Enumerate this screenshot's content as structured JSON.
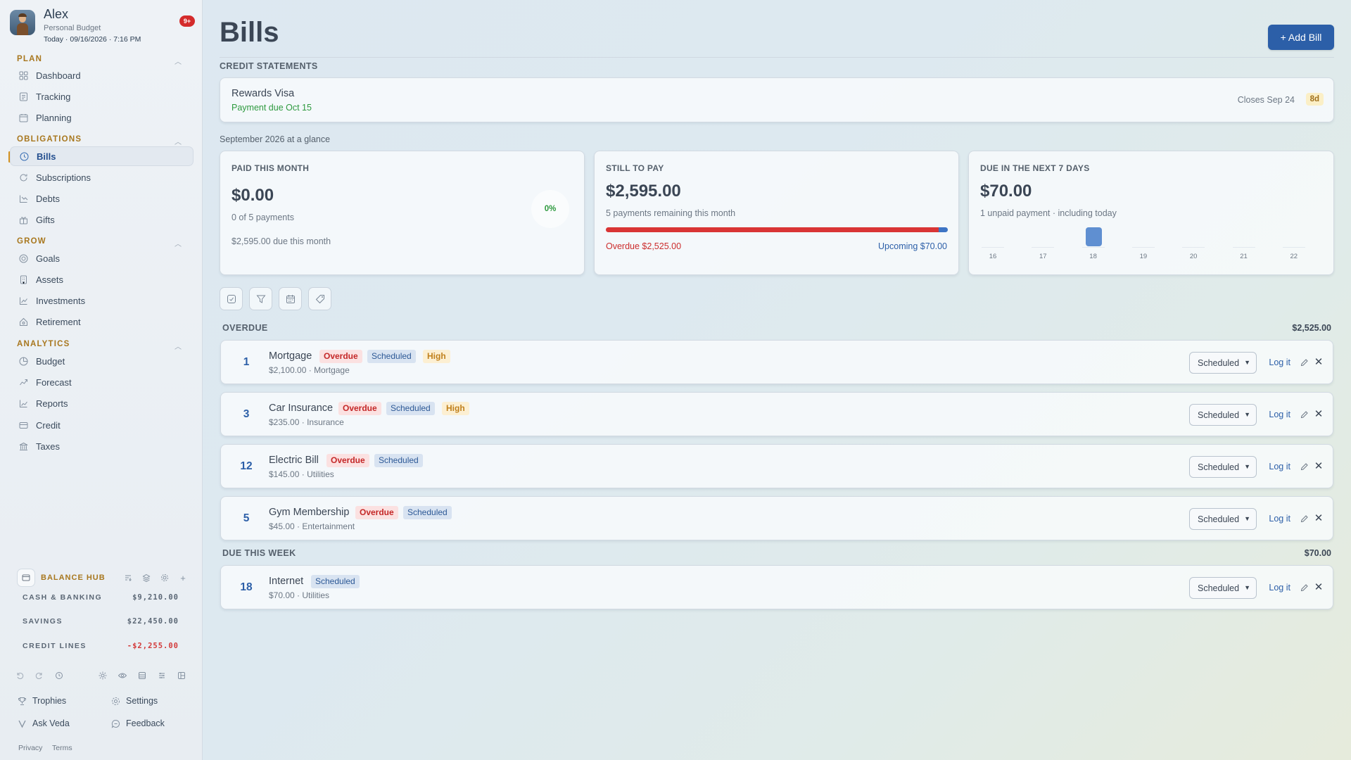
{
  "profile": {
    "name": "Alex",
    "subtitle": "Personal Budget",
    "date": "Today · 09/16/2026 · 7:16 PM",
    "notifications": "9+"
  },
  "nav": {
    "plan_title": "PLAN",
    "plan_items": [
      {
        "label": "Dashboard",
        "icon": "grid-icon"
      },
      {
        "label": "Tracking",
        "icon": "list-icon"
      },
      {
        "label": "Planning",
        "icon": "calendar-icon"
      }
    ],
    "obligations_title": "OBLIGATIONS",
    "obligations_items": [
      {
        "label": "Bills",
        "icon": "bills-icon",
        "active": true
      },
      {
        "label": "Subscriptions",
        "icon": "refresh-icon"
      },
      {
        "label": "Debts",
        "icon": "debt-icon"
      },
      {
        "label": "Gifts",
        "icon": "gift-icon"
      }
    ],
    "grow_title": "GROW",
    "grow_items": [
      {
        "label": "Goals",
        "icon": "target-icon"
      },
      {
        "label": "Assets",
        "icon": "building-icon"
      },
      {
        "label": "Investments",
        "icon": "trend-icon"
      },
      {
        "label": "Retirement",
        "icon": "nest-icon"
      }
    ],
    "analytics_title": "ANALYTICS",
    "analytics_items": [
      {
        "label": "Budget",
        "icon": "pie-icon"
      },
      {
        "label": "Forecast",
        "icon": "forecast-icon"
      },
      {
        "label": "Reports",
        "icon": "chart-icon"
      },
      {
        "label": "Credit",
        "icon": "card-icon"
      },
      {
        "label": "Taxes",
        "icon": "bank-icon"
      }
    ]
  },
  "balance_hub": {
    "title": "BALANCE HUB",
    "rows": [
      {
        "label": "CASH & BANKING",
        "value": "$9,210.00"
      },
      {
        "label": "SAVINGS",
        "value": "$22,450.00"
      },
      {
        "label": "CREDIT LINES",
        "value": "-$2,255.00"
      }
    ]
  },
  "footer": {
    "trophies": "Trophies",
    "settings": "Settings",
    "ask_veda": "Ask Veda",
    "feedback": "Feedback",
    "privacy": "Privacy",
    "terms": "Terms"
  },
  "page": {
    "title": "Bills",
    "add_button": "+ Add Bill",
    "credit_statements_label": "CREDIT STATEMENTS",
    "glance_label": "September 2026 at a glance"
  },
  "statement": {
    "name": "Rewards Visa",
    "due": "Payment due Oct 15",
    "closes": "Closes Sep 24",
    "days": "8d"
  },
  "summary": {
    "paid": {
      "label": "PAID THIS MONTH",
      "amount": "$0.00",
      "sub": "0 of 5 payments",
      "due": "$2,595.00 due this month",
      "percent": "0%"
    },
    "still": {
      "label": "STILL TO PAY",
      "amount": "$2,595.00",
      "sub": "5 payments remaining this month",
      "overdue": "Overdue $2,525.00",
      "upcoming": "Upcoming $70.00",
      "overdue_fraction": 0.973,
      "upcoming_fraction": 0.027
    },
    "next7": {
      "label": "DUE IN THE NEXT 7 DAYS",
      "amount": "$70.00",
      "sub": "1 unpaid payment · including today",
      "days": [
        {
          "day": "16",
          "amount": 0
        },
        {
          "day": "17",
          "amount": 0
        },
        {
          "day": "18",
          "amount": 70
        },
        {
          "day": "19",
          "amount": 0
        },
        {
          "day": "20",
          "amount": 0
        },
        {
          "day": "21",
          "amount": 0
        },
        {
          "day": "22",
          "amount": 0
        }
      ]
    }
  },
  "groups": {
    "overdue": {
      "label": "OVERDUE",
      "total": "$2,525.00"
    },
    "week": {
      "label": "DUE THIS WEEK",
      "total": "$70.00"
    }
  },
  "bills": [
    {
      "day": "1",
      "name": "Mortgage",
      "amount": "$2,100.00",
      "category": "· Mortgage",
      "badges": [
        "Overdue",
        "Scheduled",
        "High"
      ],
      "status": "Scheduled"
    },
    {
      "day": "3",
      "name": "Car Insurance",
      "amount": "$235.00",
      "category": "· Insurance",
      "badges": [
        "Overdue",
        "Scheduled",
        "High"
      ],
      "status": "Scheduled"
    },
    {
      "day": "12",
      "name": "Electric Bill",
      "amount": "$145.00",
      "category": "· Utilities",
      "badges": [
        "Overdue",
        "Scheduled"
      ],
      "status": "Scheduled"
    },
    {
      "day": "5",
      "name": "Gym Membership",
      "amount": "$45.00",
      "category": "· Entertainment",
      "badges": [
        "Overdue",
        "Scheduled"
      ],
      "status": "Scheduled"
    },
    {
      "day": "18",
      "name": "Internet",
      "amount": "$70.00",
      "category": "· Utilities",
      "badges": [
        "Scheduled"
      ],
      "status": "Scheduled"
    }
  ],
  "labels": {
    "log_it": "Log it"
  },
  "colors": {
    "accent": "#2c5fa8",
    "overdue": "#d93535",
    "paid": "#2e9a3f",
    "section": "#a8771e"
  }
}
